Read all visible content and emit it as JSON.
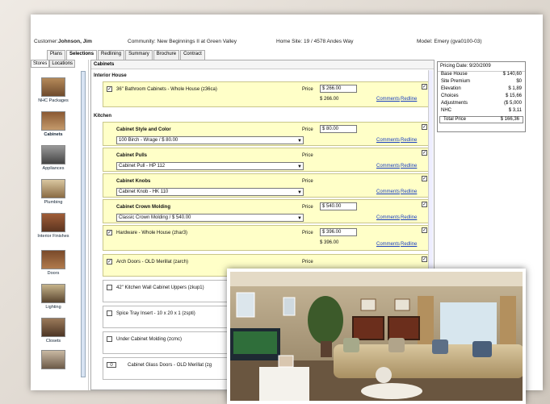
{
  "header": {
    "customer_label": "Customer:",
    "customer_name": "Johnson, Jim",
    "community": "Community: New Beginnings II at Green Valley",
    "home_site": "Home Site: 19 / 4578 Andes Way",
    "model": "Model: Emery (gva0100-03)"
  },
  "tabs": [
    "Plans",
    "Selections",
    "Redlining",
    "Summary",
    "Brochure",
    "Contract"
  ],
  "left_tabs": [
    "Stores",
    "Locations"
  ],
  "categories": [
    "NHC Packages",
    "Cabinets",
    "Appliances",
    "Plumbing",
    "Interior Finishes",
    "Doors",
    "Lighting",
    "Closets"
  ],
  "main": {
    "title": "Cabinets",
    "sections": [
      "Interior House",
      "Kitchen"
    ],
    "price_label": "Price",
    "comments": "Comments",
    "redline": "Redline",
    "rows": [
      {
        "title": "36\" Bathroom Cabinets - Whole House (z36ca)",
        "price": "$ 266.00",
        "sub": "$ 266.00"
      },
      {
        "title": "Cabinet Style and Color",
        "price": "$ 80.00",
        "select": "100 Birch - Wrage / $ 80.00"
      },
      {
        "title": "Cabinet Pulls",
        "select": "Cabinet Pull - HP 112"
      },
      {
        "title": "Cabinet Knobs",
        "select": "Cabinet Knob - HK 110"
      },
      {
        "title": "Cabinet Crown Molding",
        "price": "$ 540.00",
        "select": "Classic Crown Molding / $ 540.00"
      },
      {
        "title": "Hardware - Whole House (zhar3)",
        "price": "$ 396.00",
        "sub": "$ 396.00"
      },
      {
        "title": "Arch Doors - OLD Merillat (zarch)"
      },
      {
        "title": "42\" Kitchen Wall Cabinet Uppers (zkup1)"
      },
      {
        "title": "Spice Tray Insert - 10 x 20 x 1 (zspti)"
      },
      {
        "title": "Under Cabinet Molding (zcmc)"
      },
      {
        "title": "Cabinet Glass Doors - OLD Merillat (zg",
        "qty": "0"
      }
    ]
  },
  "pricing": {
    "title": "Pricing   Date: 9/20/2009",
    "rows": [
      {
        "label": "Base House",
        "value": "$ 140,60"
      },
      {
        "label": "Site Premium",
        "value": "$0"
      },
      {
        "label": "Elevation",
        "value": "$ 1,89"
      },
      {
        "label": "Choices",
        "value": "$ 15,66"
      },
      {
        "label": "Adjustments",
        "value": "($ 5,000"
      },
      {
        "label": "NHC",
        "value": "$ 3,11"
      }
    ],
    "total_label": "Total Price",
    "total_value": "$ 166,36"
  },
  "colors": {
    "row_yellow": "#ffffc8",
    "link": "#1a3fbf"
  }
}
